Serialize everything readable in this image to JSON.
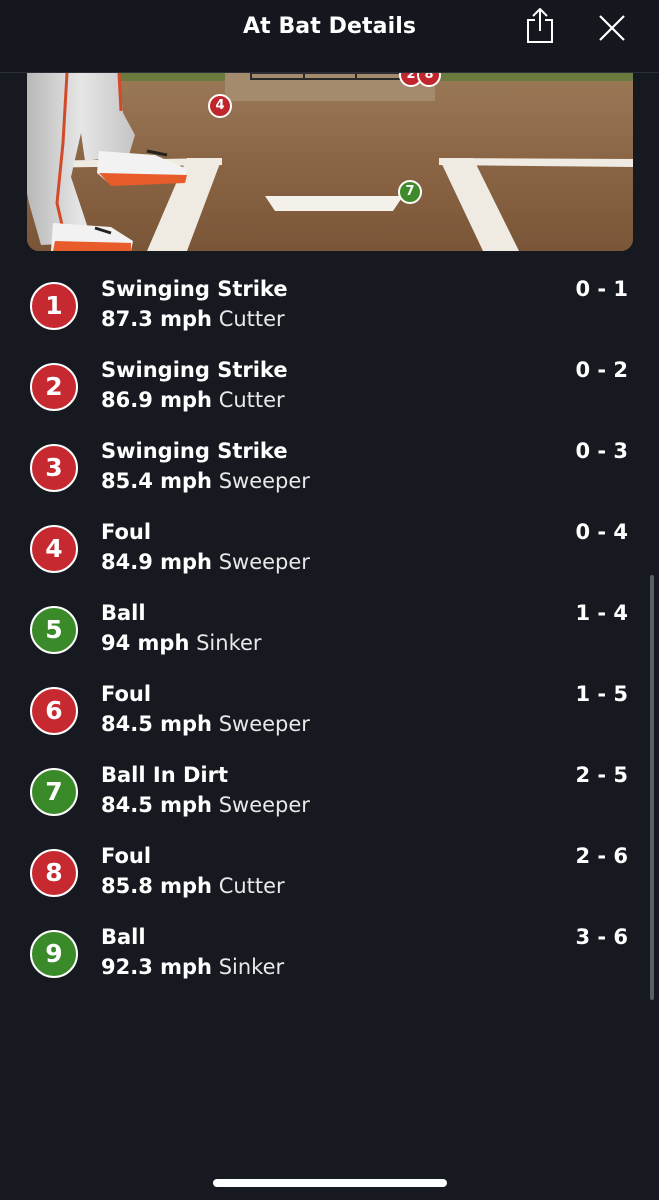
{
  "header": {
    "title": "At Bat Details",
    "share_icon": "share-icon",
    "close_icon": "close-icon"
  },
  "zone": {
    "markers": [
      {
        "number": "2",
        "result": "strike"
      },
      {
        "number": "8",
        "result": "strike"
      },
      {
        "number": "4",
        "result": "strike"
      },
      {
        "number": "7",
        "result": "ball"
      }
    ]
  },
  "colors": {
    "strike": "#c62a30",
    "ball": "#3a8a2a",
    "background": "#161a20"
  },
  "pitches": [
    {
      "number": "1",
      "result": "Swinging Strike",
      "speed": "87.3 mph",
      "type": "Cutter",
      "count": "0 - 1",
      "kind": "red"
    },
    {
      "number": "2",
      "result": "Swinging Strike",
      "speed": "86.9 mph",
      "type": "Cutter",
      "count": "0 - 2",
      "kind": "red"
    },
    {
      "number": "3",
      "result": "Swinging Strike",
      "speed": "85.4 mph",
      "type": "Sweeper",
      "count": "0 - 3",
      "kind": "red"
    },
    {
      "number": "4",
      "result": "Foul",
      "speed": "84.9 mph",
      "type": "Sweeper",
      "count": "0 - 4",
      "kind": "red"
    },
    {
      "number": "5",
      "result": "Ball",
      "speed": "94 mph",
      "type": "Sinker",
      "count": "1 - 4",
      "kind": "green"
    },
    {
      "number": "6",
      "result": "Foul",
      "speed": "84.5 mph",
      "type": "Sweeper",
      "count": "1 - 5",
      "kind": "red"
    },
    {
      "number": "7",
      "result": "Ball In Dirt",
      "speed": "84.5 mph",
      "type": "Sweeper",
      "count": "2 - 5",
      "kind": "green"
    },
    {
      "number": "8",
      "result": "Foul",
      "speed": "85.8 mph",
      "type": "Cutter",
      "count": "2 - 6",
      "kind": "red"
    },
    {
      "number": "9",
      "result": "Ball",
      "speed": "92.3 mph",
      "type": "Sinker",
      "count": "3 - 6",
      "kind": "green"
    }
  ]
}
